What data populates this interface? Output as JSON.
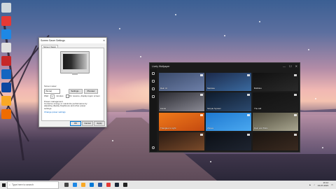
{
  "colors": {
    "accent_blue": "#0078d7",
    "app_bg": "#1b1b1b",
    "taskbar_bg": "#e6e6e6"
  },
  "desktop": {
    "icons": [
      {
        "label": "",
        "icon": "recycle-bin-icon",
        "color": "#cfd8dc"
      },
      {
        "label": "",
        "icon": "chrome-icon",
        "color": "#e53935"
      },
      {
        "label": "",
        "icon": "edge-icon",
        "color": "#1e88e5"
      },
      {
        "label": "",
        "icon": "app-icon",
        "color": "#e0e0e0"
      },
      {
        "label": "",
        "icon": "game-icon",
        "color": "#c62828"
      },
      {
        "label": "",
        "icon": "steam-icon",
        "color": "#1565c0"
      },
      {
        "label": "",
        "icon": "shield-icon",
        "color": "#0d47a1"
      },
      {
        "label": "",
        "icon": "folder-icon",
        "color": "#f9a825"
      },
      {
        "label": "",
        "icon": "vlc-icon",
        "color": "#ef6c00"
      }
    ]
  },
  "screensaver_dialog": {
    "title": "Screen Saver Settings",
    "tab_label": "Screen Saver",
    "section_label": "Screen saver",
    "selected_saver": "(None)",
    "settings_label": "Settings...",
    "preview_label": "Preview",
    "wait_label": "Wait:",
    "wait_value": "1",
    "minutes_label": "minutes",
    "resume_label": "On resume, display logon screen",
    "power_heading": "Power management",
    "power_text": "Conserve energy or maximize performance by adjusting display brightness and other power settings.",
    "power_link": "Change power settings",
    "ok_label": "OK",
    "cancel_label": "Cancel",
    "apply_label": "Apply"
  },
  "wallpaper_app": {
    "title": "Lively Wallpaper",
    "tiles": [
      {
        "title": "Rain UI",
        "subtitle": "",
        "bg": "linear-gradient(160deg,#3a4a6a,#6d7fa8)"
      },
      {
        "title": "Medusa",
        "subtitle": "",
        "bg": "linear-gradient(160deg,#1c2a4a,#3a6aa0)"
      },
      {
        "title": "Bubbles",
        "subtitle": "",
        "bg": "linear-gradient(160deg,#101010,#2a2a2a)"
      },
      {
        "title": "Fluids",
        "subtitle": "",
        "bg": "linear-gradient(160deg,#2a2a30,#8a8a95)"
      },
      {
        "title": "Simple System",
        "subtitle": "",
        "bg": "linear-gradient(160deg,#0e1a2a,#2c4a70)"
      },
      {
        "title": "The Hill",
        "subtitle": "",
        "bg": "linear-gradient(160deg,#121212,#1f1f1f)"
      },
      {
        "title": "Triangles & Light",
        "subtitle": "",
        "bg": "linear-gradient(160deg,#f07a1a,#c44a10)"
      },
      {
        "title": "Waves",
        "subtitle": "",
        "bg": "linear-gradient(160deg,#1e78d0,#4aa8f0)"
      },
      {
        "title": "Rain and Bolts",
        "subtitle": "",
        "bg": "linear-gradient(160deg,#4e4a3a,#a9a690)"
      },
      {
        "title": "",
        "subtitle": "",
        "bg": "linear-gradient(160deg,#2a1a12,#7a4a2a)"
      },
      {
        "title": "",
        "subtitle": "",
        "bg": "linear-gradient(160deg,#0b0f15,#1e2430)"
      },
      {
        "title": "",
        "subtitle": "",
        "bg": "linear-gradient(160deg,#1a1410,#3a2a20)"
      }
    ]
  },
  "taskbar": {
    "search_placeholder": "Type here to search",
    "apps": [
      {
        "icon": "task-view-icon",
        "color": "#444"
      },
      {
        "icon": "edge-icon",
        "color": "#1e88e5"
      },
      {
        "icon": "file-explorer-icon",
        "color": "#f9a825"
      },
      {
        "icon": "store-icon",
        "color": "#0078d7"
      },
      {
        "icon": "mail-icon",
        "color": "#2b579a"
      },
      {
        "icon": "chrome-icon",
        "color": "#e53935"
      },
      {
        "icon": "steam-icon",
        "color": "#1b2838"
      },
      {
        "icon": "wallpaper-app-icon",
        "color": "#222"
      }
    ],
    "time": "16:12",
    "date": "04-07-2023"
  }
}
